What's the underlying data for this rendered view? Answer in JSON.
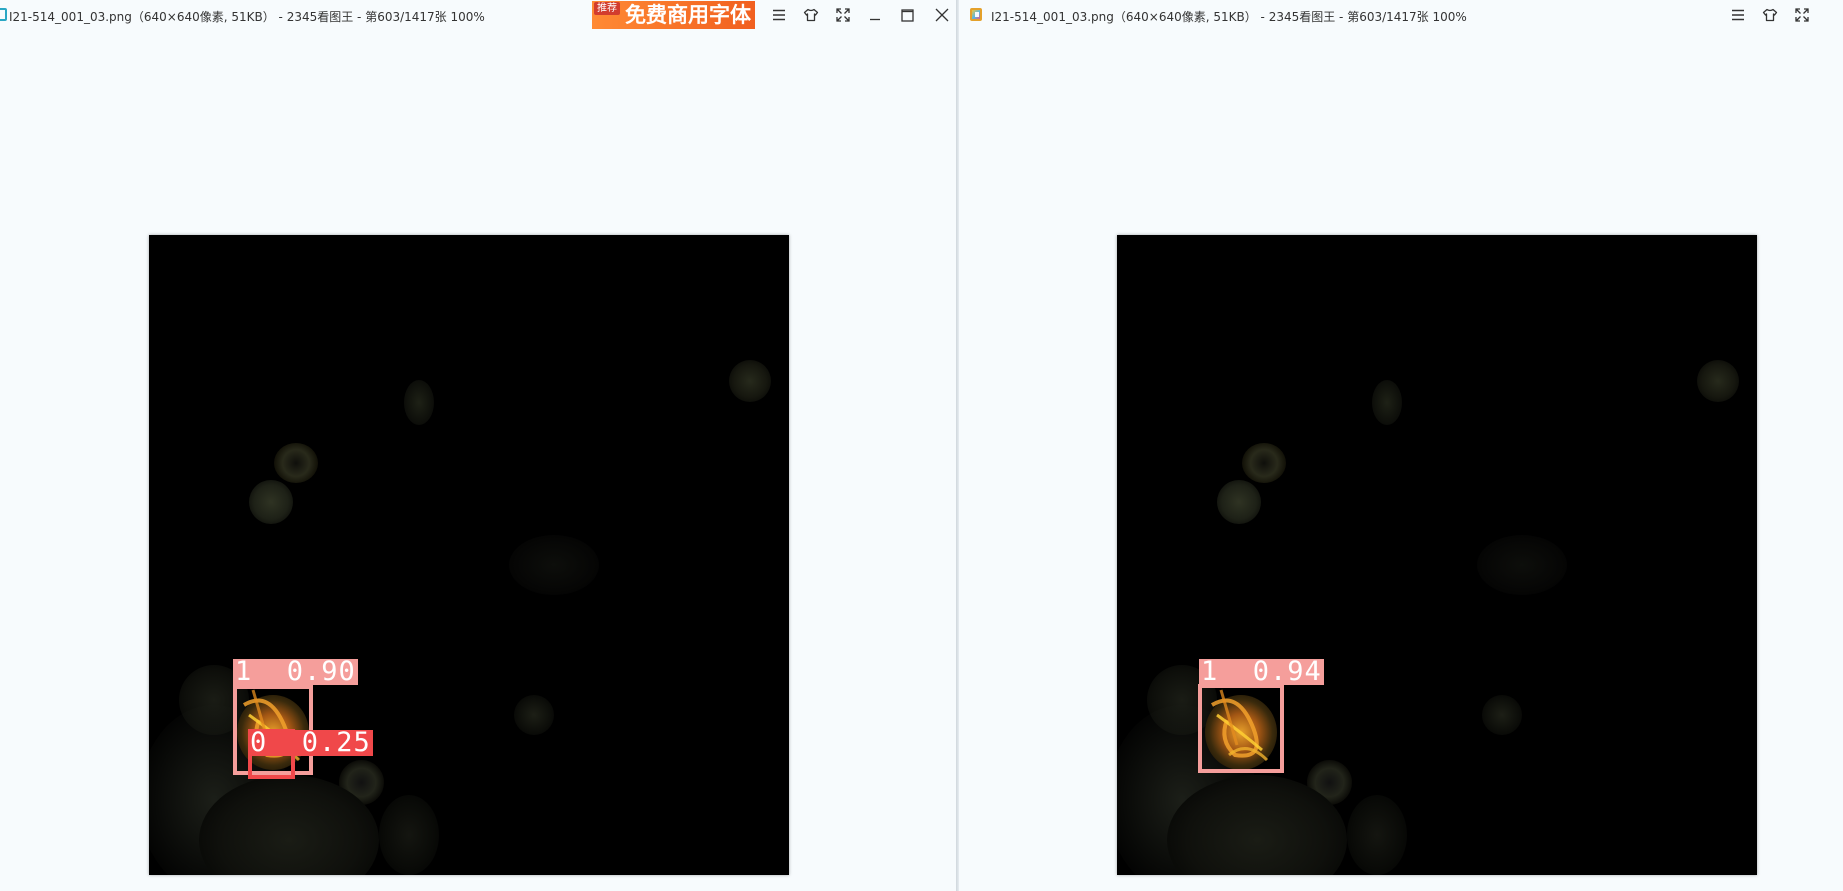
{
  "left_window": {
    "title": "I21-514_001_03.png（640×640像素, 51KB） - 2345看图王 - 第603/1417张 100%",
    "ad": {
      "tag": "推荐",
      "text": "免费商用字体"
    },
    "detections": [
      {
        "label": "1  0.90",
        "color": "#f59e9b"
      },
      {
        "label": "0  0.25",
        "color": "#f0484a"
      }
    ]
  },
  "right_window": {
    "title": "I21-514_001_03.png（640×640像素, 51KB） - 2345看图王 - 第603/1417张 100%",
    "detections": [
      {
        "label": "1  0.94",
        "color": "#f59e9b"
      }
    ]
  },
  "icons": {
    "menu": "menu-icon",
    "skin": "skin-icon",
    "fullscreen": "fullscreen-icon",
    "minimize": "minimize-icon",
    "maximize": "maximize-icon",
    "close": "close-icon"
  }
}
